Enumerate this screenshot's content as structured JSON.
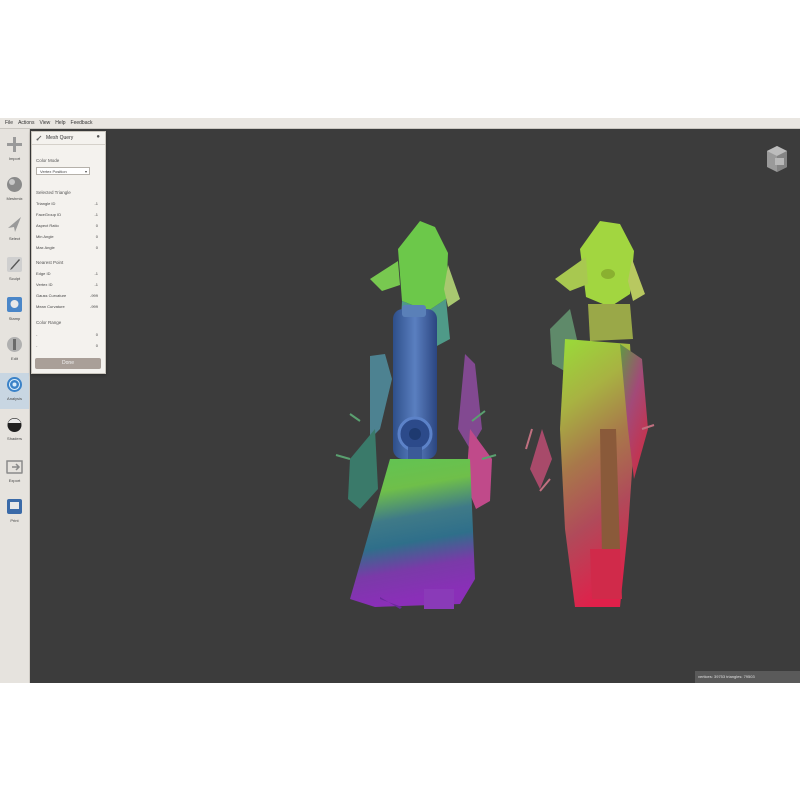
{
  "menu": [
    "File",
    "Actions",
    "View",
    "Help",
    "Feedback"
  ],
  "toolbar": [
    {
      "label": "Import",
      "icon": "plus-icon"
    },
    {
      "label": "Meshmix",
      "icon": "sphere-icon"
    },
    {
      "label": "Select",
      "icon": "cursor-arrow-icon"
    },
    {
      "label": "Sculpt",
      "icon": "brush-icon"
    },
    {
      "label": "Stamp",
      "icon": "stamp-icon"
    },
    {
      "label": "Edit",
      "icon": "edit-sphere-icon"
    },
    {
      "label": "Analysis",
      "icon": "analysis-globe-icon"
    },
    {
      "label": "Shaders",
      "icon": "shader-ball-icon"
    },
    {
      "label": "Export",
      "icon": "export-icon"
    },
    {
      "label": "Print",
      "icon": "print-icon"
    }
  ],
  "active_tool": "Analysis",
  "panel": {
    "title": "Mesh Query",
    "color_mode_label": "Color Mode",
    "color_mode_value": "Vertex Position",
    "selected_triangle_label": "Selected Triangle",
    "triangle_rows": [
      {
        "label": "Triangle ID",
        "value": "-1"
      },
      {
        "label": "FaceGroup ID",
        "value": "-1"
      },
      {
        "label": "Aspect Ratio",
        "value": "0"
      },
      {
        "label": "Min Angle",
        "value": "0"
      },
      {
        "label": "Max Angle",
        "value": "0"
      }
    ],
    "nearest_point_label": "Nearest Point",
    "point_rows": [
      {
        "label": "Edge ID",
        "value": "-1"
      },
      {
        "label": "Vertex ID",
        "value": "-1"
      },
      {
        "label": "Gauss Curvature",
        "value": "-999"
      },
      {
        "label": "Mean Curvature",
        "value": "-999"
      }
    ],
    "color_range_label": "Color Range",
    "range_rows": [
      {
        "label": "-",
        "value": "0"
      },
      {
        "label": "-",
        "value": "0"
      }
    ],
    "done_label": "Done"
  },
  "status": "vertices: 39753 triangles: 79503",
  "colors": {
    "viewport_bg": "#3c3c3c",
    "active_tool_bg": "#c8d6e2",
    "done_button": "#a99f98"
  }
}
